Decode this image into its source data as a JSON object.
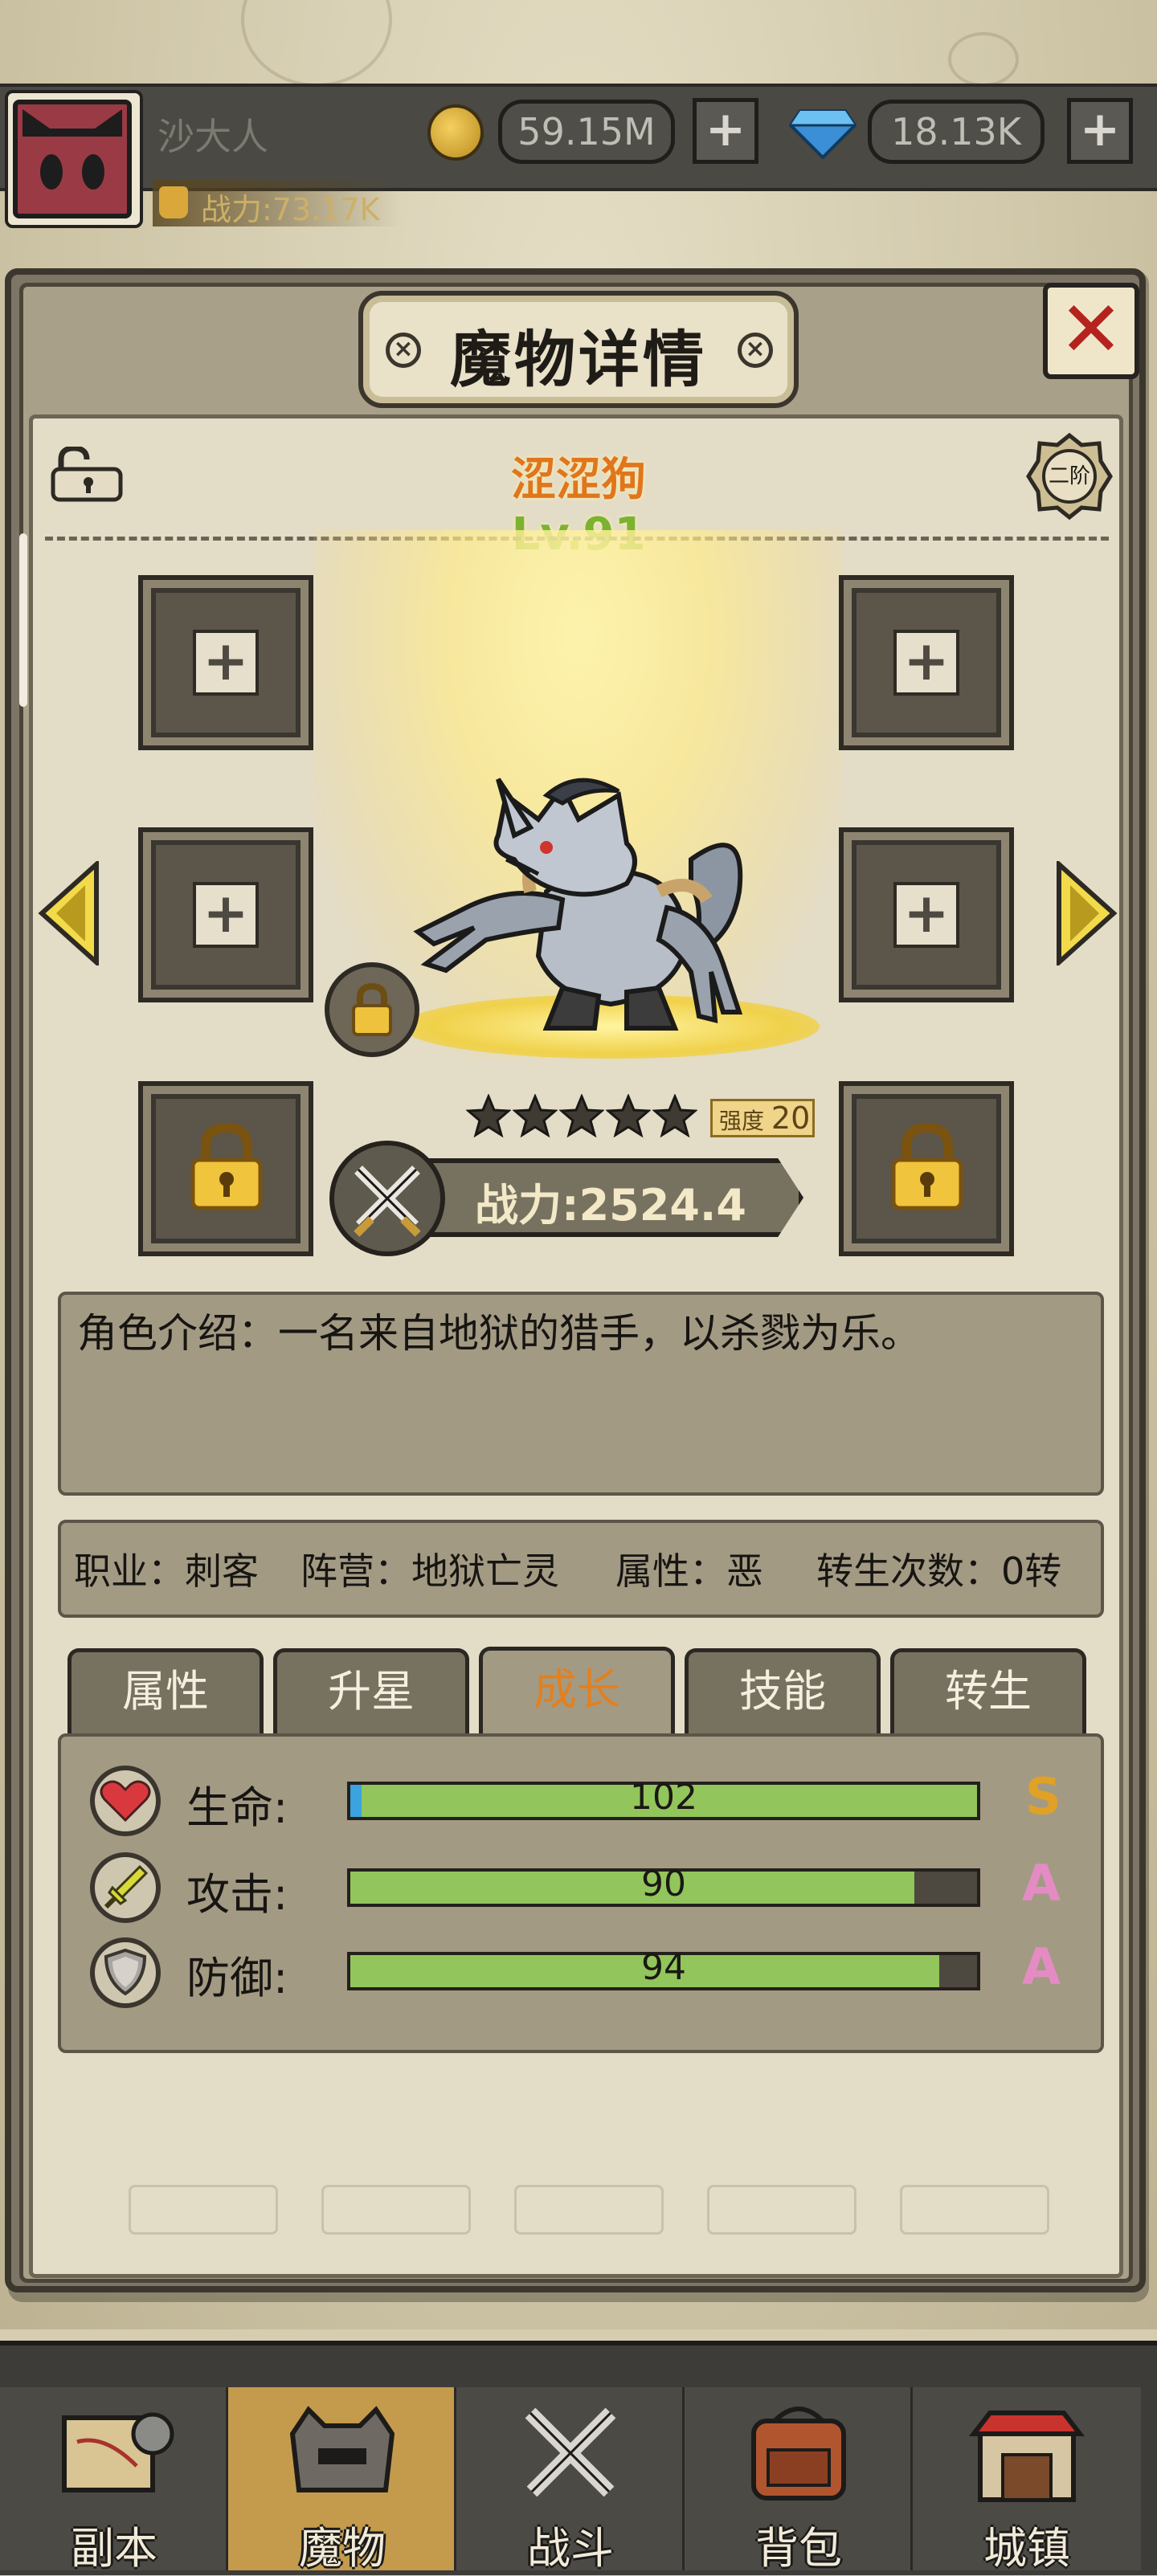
{
  "hud": {
    "player_name": "沙大人",
    "power": "战力:73.17K",
    "gold": "59.15M",
    "gems": "18.13K",
    "plus": "+"
  },
  "panel": {
    "title": "魔物详情",
    "close": "✕",
    "title_dot": "×"
  },
  "monster": {
    "name": "涩涩狗",
    "level": "Lv.91",
    "rank": "二阶",
    "stars": 5,
    "strength_label": "强度",
    "strength_value": "20",
    "combat_power": "战力:2524.4",
    "intro": "角色介绍：一名来自地狱的猎手，以杀戮为乐。"
  },
  "slots": {
    "plus": "+"
  },
  "info": {
    "job": "职业：刺客",
    "camp": "阵营：地狱亡灵",
    "attribute": "属性：恶",
    "rebirth": "转生次数：0转"
  },
  "tabs": [
    "属性",
    "升星",
    "成长",
    "技能",
    "转生"
  ],
  "active_tab": "成长",
  "stats": [
    {
      "label": "生命:",
      "value": "102",
      "grade": "S",
      "fill": 1.0,
      "icon": "heart-icon",
      "grade_color": "#e0a126"
    },
    {
      "label": "攻击:",
      "value": "90",
      "grade": "A",
      "fill": 0.9,
      "icon": "sword-icon",
      "grade_color": "#e48bc4"
    },
    {
      "label": "防御:",
      "value": "94",
      "grade": "A",
      "fill": 0.94,
      "icon": "shield-icon",
      "grade_color": "#e48bc4"
    }
  ],
  "nav": [
    "副本",
    "魔物",
    "战斗",
    "背包",
    "城镇"
  ],
  "active_nav": "魔物",
  "colors": {
    "accent_orange": "#e2801f",
    "level_green": "#7bb331",
    "bar_green": "#92c55b",
    "close_red": "#b5231f"
  }
}
